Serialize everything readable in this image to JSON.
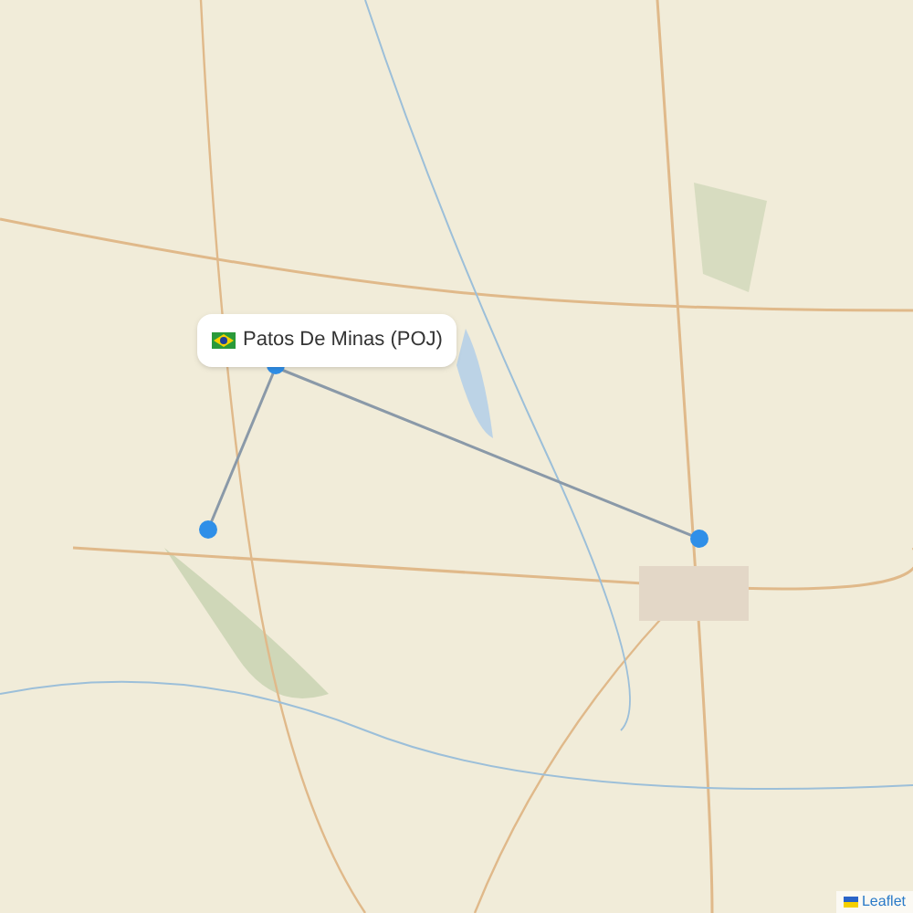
{
  "popup": {
    "label": "Patos De Minas (POJ)"
  },
  "attribution": {
    "link": "Leaflet"
  }
}
